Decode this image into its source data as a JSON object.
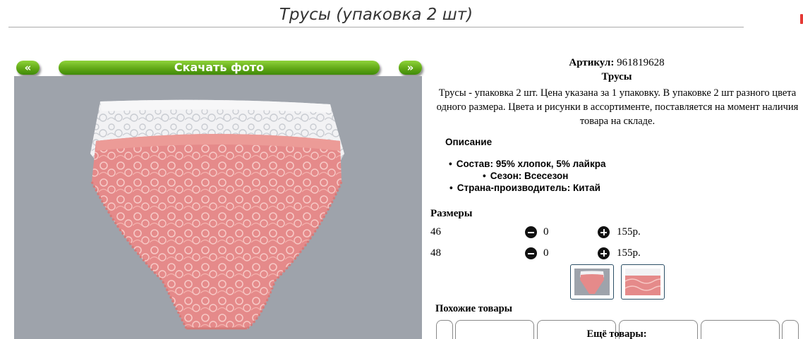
{
  "page": {
    "title": "Трусы (упаковка 2 шт)"
  },
  "gallery": {
    "prev_label": "«",
    "download_label": "Скачать фото",
    "next_label": "»"
  },
  "product": {
    "article_label": "Артикул:",
    "article_value": "961819628",
    "name": "Трусы",
    "description": "Трусы - упаковка 2 шт. Цена указана за 1 упаковку. В упаковке 2 шт разного цвета одного размера. Цвета и рисунки в ассортименте, поставляется на момент наличия товара на складе."
  },
  "details": {
    "heading": "Описание",
    "specs": [
      "Состав: 95% хлопок, 5% лайкра",
      "Сезон: Всесезон",
      "Страна-производитель: Китай"
    ]
  },
  "sizes": {
    "heading": "Размеры",
    "rows": [
      {
        "size": "46",
        "qty": "0",
        "price": "155р."
      },
      {
        "size": "48",
        "qty": "0",
        "price": "155р."
      }
    ]
  },
  "similar": {
    "heading": "Похожие товары",
    "more_label": "Ещё товары:"
  },
  "colors": {
    "button_green": "#5ea514",
    "photo_background": "#9ea3ab",
    "pink_item": "#e58a8a",
    "white_item": "#f2f2f4"
  }
}
